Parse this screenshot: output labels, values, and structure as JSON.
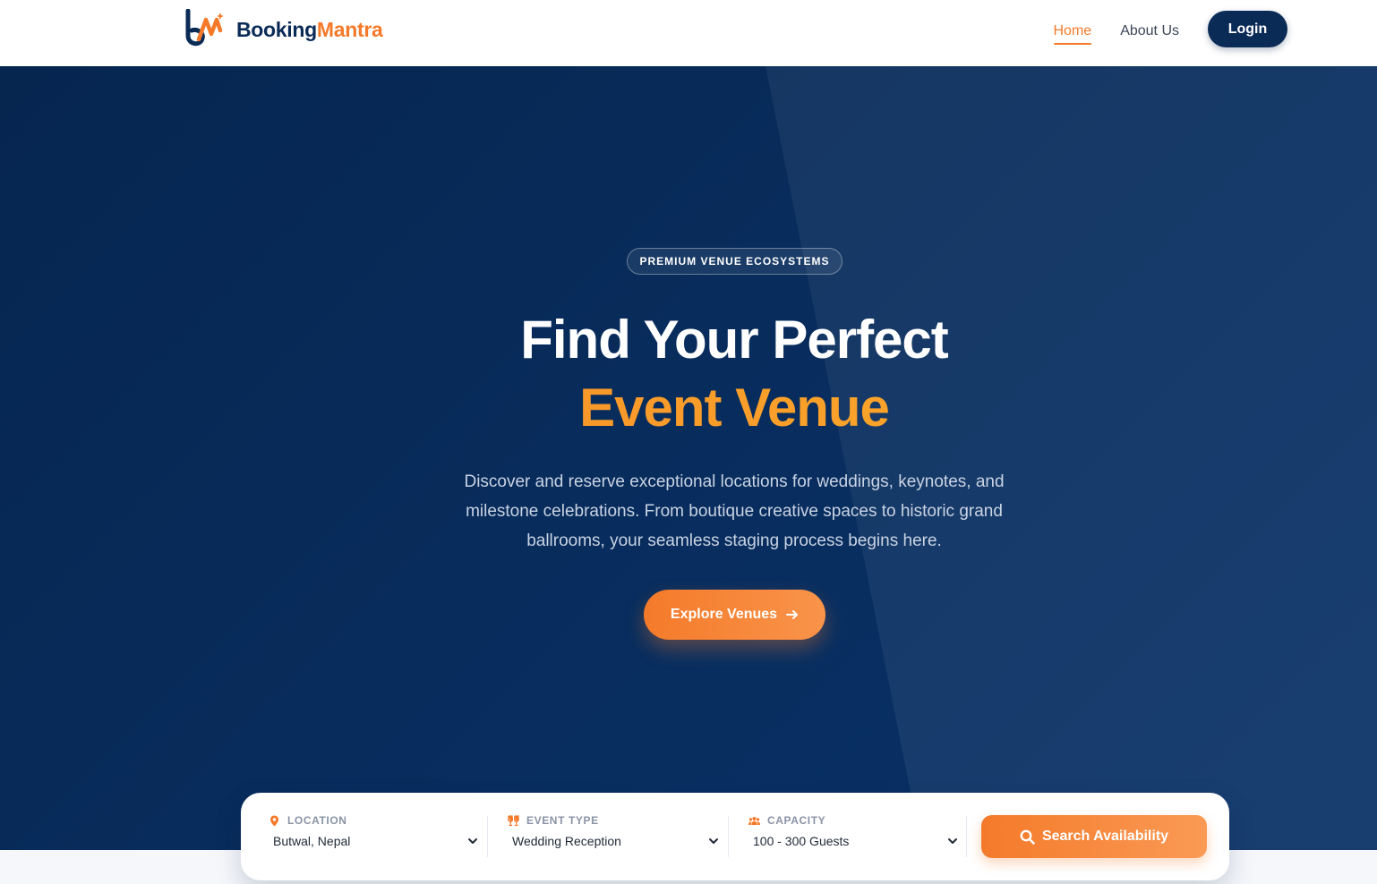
{
  "brand": {
    "part1": "Booking",
    "part2": "Mantra",
    "primary_color": "#0b2b57",
    "accent_color": "#f47a2a"
  },
  "nav": {
    "links": [
      {
        "label": "Home",
        "active": true
      },
      {
        "label": "About Us",
        "active": false
      }
    ],
    "login_label": "Login"
  },
  "hero": {
    "badge": "PREMIUM VENUE ECOSYSTEMS",
    "title_line1": "Find Your Perfect",
    "title_line2": "Event Venue",
    "description": "Discover and reserve exceptional locations for weddings, keynotes, and milestone celebrations. From boutique creative spaces to historic grand ballrooms, your seamless staging process begins here.",
    "cta_label": "Explore Venues",
    "cta_icon": "arrow-right-icon"
  },
  "search": {
    "location": {
      "label": "LOCATION",
      "value": "Butwal, Nepal",
      "icon": "map-pin-icon"
    },
    "event_type": {
      "label": "EVENT TYPE",
      "value": "Wedding Reception",
      "icon": "glasses-cheers-icon"
    },
    "capacity": {
      "label": "CAPACITY",
      "value": "100 - 300 Guests",
      "icon": "users-icon"
    },
    "button_label": "Search Availability",
    "button_icon": "search-icon"
  }
}
